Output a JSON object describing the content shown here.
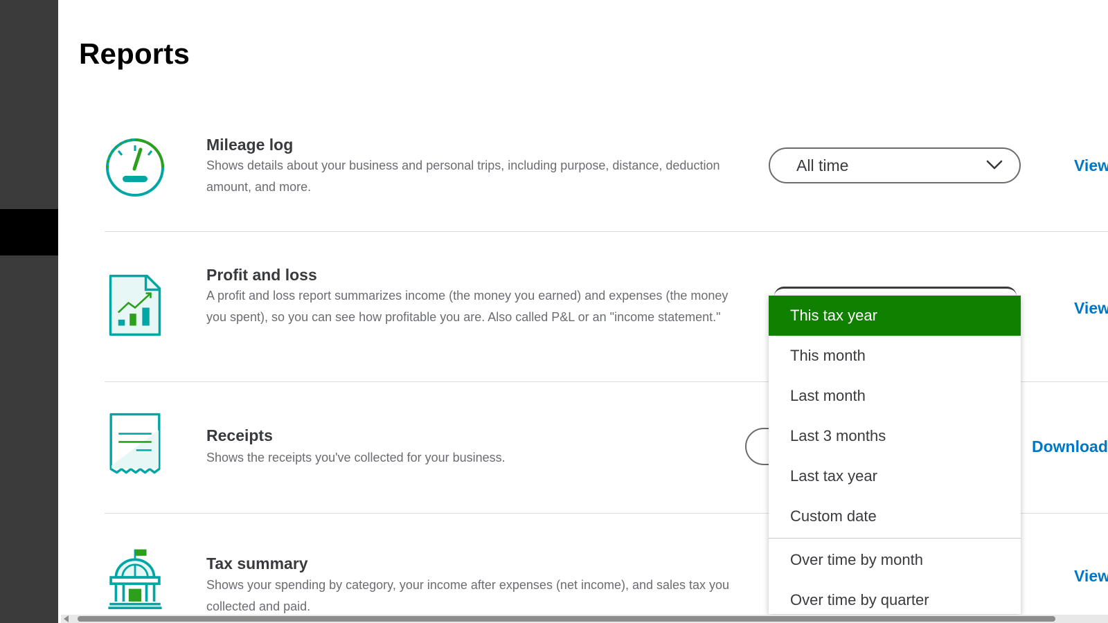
{
  "page": {
    "title": "Reports"
  },
  "colors": {
    "accent_green": "#108000",
    "link_blue": "#0077c5",
    "icon_teal": "#00a6a4",
    "icon_green": "#2ca01c"
  },
  "reports": [
    {
      "title": "Mileage log",
      "description": "Shows details about your business and personal trips, including purpose, distance, deduction amount, and more.",
      "action": "View",
      "icon": "speedometer-icon"
    },
    {
      "title": "Profit and loss",
      "description": "A profit and loss report summarizes income (the money you earned) and expenses (the money you spent), so you can see how profitable you are. Also called P&L or an \"income statement.\"",
      "action": "View",
      "icon": "growth-chart-document-icon"
    },
    {
      "title": "Receipts",
      "description": "Shows the receipts you've collected for your business.",
      "action": "Download",
      "icon": "receipt-icon"
    },
    {
      "title": "Tax summary",
      "description": "Shows your spending by category, your income after expenses (net income), and sales tax you collected and paid.",
      "action": "View",
      "icon": "government-building-icon"
    }
  ],
  "mileage_range": {
    "selected": "All time",
    "icon": "chevron-down-icon"
  },
  "dropdown": {
    "items": [
      "This tax year",
      "This month",
      "Last month",
      "Last 3 months",
      "Last tax year",
      "Custom date"
    ],
    "group2": [
      "Over time by month",
      "Over time by quarter"
    ],
    "selected": "This tax year"
  }
}
